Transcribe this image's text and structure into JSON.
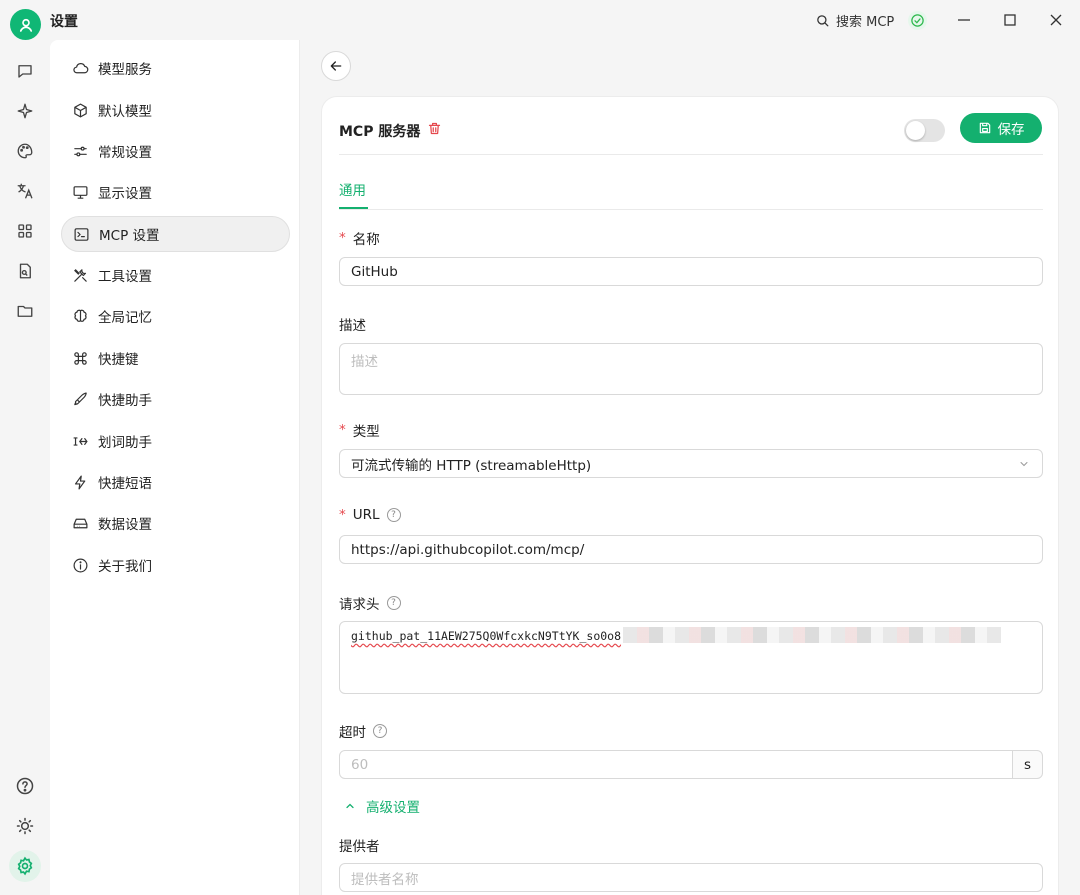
{
  "window": {
    "title": "设置",
    "search_label": "搜索 MCP"
  },
  "colors": {
    "accent": "#14b06f",
    "required": "#e5484d",
    "danger": "#e5484d"
  },
  "rail": {
    "top_icons": [
      "chat-icon",
      "sparkle-icon",
      "palette-icon",
      "translate-icon",
      "apps-icon",
      "file-search-icon",
      "folder-icon"
    ],
    "bottom_icons": [
      "help-circle-icon",
      "theme-toggle-icon",
      "settings-icon"
    ]
  },
  "menu": {
    "items": [
      {
        "label": "模型服务",
        "icon": "cloud-icon"
      },
      {
        "label": "默认模型",
        "icon": "cube-icon"
      },
      {
        "label": "常规设置",
        "icon": "sliders-icon"
      },
      {
        "label": "显示设置",
        "icon": "monitor-icon"
      },
      {
        "label": "MCP 设置",
        "icon": "terminal-icon"
      },
      {
        "label": "工具设置",
        "icon": "tools-icon"
      },
      {
        "label": "全局记忆",
        "icon": "brain-icon"
      },
      {
        "label": "快捷键",
        "icon": "command-icon"
      },
      {
        "label": "快捷助手",
        "icon": "rocket-icon"
      },
      {
        "label": "划词助手",
        "icon": "text-select-icon"
      },
      {
        "label": "快捷短语",
        "icon": "zap-icon"
      },
      {
        "label": "数据设置",
        "icon": "hard-drive-icon"
      },
      {
        "label": "关于我们",
        "icon": "info-icon"
      }
    ],
    "active_index": 4
  },
  "server": {
    "title": "MCP 服务器",
    "enabled": false,
    "save_label": "保存",
    "tab_general": "通用",
    "name_label": "名称",
    "name_value": "GitHub",
    "description_label": "描述",
    "description_placeholder": "描述",
    "type_label": "类型",
    "type_value": "可流式传输的 HTTP (streamableHttp)",
    "url_label": "URL",
    "url_value": "https://api.githubcopilot.com/mcp/",
    "headers_label": "请求头",
    "headers_value": "github_pat_11AEW275Q0WfcxkcN9TtYK_so0o8",
    "timeout_label": "超时",
    "timeout_placeholder": "60",
    "timeout_unit": "s",
    "advanced_label": "高级设置",
    "provider_label": "提供者",
    "provider_placeholder": "提供者名称"
  }
}
